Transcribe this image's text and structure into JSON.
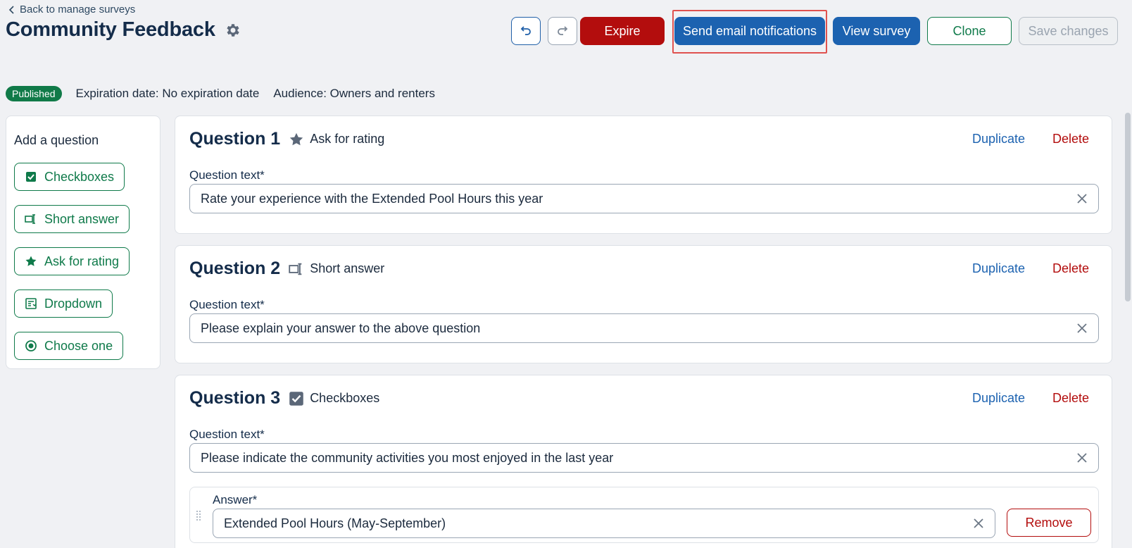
{
  "header": {
    "back_label": "Back to manage surveys",
    "title": "Community Feedback"
  },
  "toolbar": {
    "expire_label": "Expire",
    "send_label": "Send email notifications",
    "view_label": "View survey",
    "clone_label": "Clone",
    "save_label": "Save changes"
  },
  "status": {
    "badge": "Published",
    "expiration": "Expiration date: No expiration date",
    "audience": "Audience: Owners and renters"
  },
  "sidebar": {
    "title": "Add a question",
    "items": [
      {
        "label": "Checkboxes",
        "icon": "checkbox-icon"
      },
      {
        "label": "Short answer",
        "icon": "text-cursor-icon"
      },
      {
        "label": "Ask for rating",
        "icon": "star-icon"
      },
      {
        "label": "Dropdown",
        "icon": "dropdown-icon"
      },
      {
        "label": "Choose one",
        "icon": "radio-icon"
      }
    ]
  },
  "questions": [
    {
      "title": "Question 1",
      "type": "Ask for rating",
      "icon": "star-icon",
      "label": "Question text*",
      "value": "Rate your experience with the Extended Pool Hours this year",
      "duplicate": "Duplicate",
      "delete": "Delete"
    },
    {
      "title": "Question 2",
      "type": "Short answer",
      "icon": "text-cursor-icon",
      "label": "Question text*",
      "value": "Please explain your answer to the above question",
      "duplicate": "Duplicate",
      "delete": "Delete"
    },
    {
      "title": "Question 3",
      "type": "Checkboxes",
      "icon": "checkbox-icon",
      "label": "Question text*",
      "value": "Please indicate the community activities you most enjoyed in the last year",
      "duplicate": "Duplicate",
      "delete": "Delete",
      "answer": {
        "label": "Answer*",
        "value": "Extended Pool Hours (May-September)",
        "remove": "Remove"
      }
    }
  ],
  "colors": {
    "accent": "#1c62b0",
    "danger": "#b30d0d",
    "success": "#0f7a4a"
  }
}
